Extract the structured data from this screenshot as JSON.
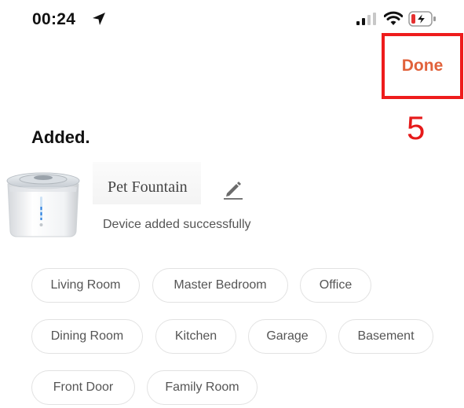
{
  "status_bar": {
    "time": "00:24",
    "icons": [
      "location-arrow-icon",
      "cellular-signal-icon",
      "wifi-icon",
      "battery-charging-icon"
    ]
  },
  "header": {
    "done_label": "Done"
  },
  "annotation": {
    "step_number": "5",
    "color": "#e61a1a"
  },
  "colors": {
    "accent": "#e1623b",
    "chip_border": "#e2e2e2",
    "highlight_box": "#ee1c1c"
  },
  "main": {
    "title": "Added.",
    "device": {
      "name": "Pet Fountain",
      "status": "Device added successfully"
    },
    "rooms": [
      {
        "label": "Living Room"
      },
      {
        "label": "Master Bedroom"
      },
      {
        "label": "Office"
      },
      {
        "label": "Dining Room"
      },
      {
        "label": "Kitchen"
      },
      {
        "label": "Garage"
      },
      {
        "label": "Basement"
      },
      {
        "label": "Front Door"
      },
      {
        "label": "Family Room"
      }
    ]
  }
}
